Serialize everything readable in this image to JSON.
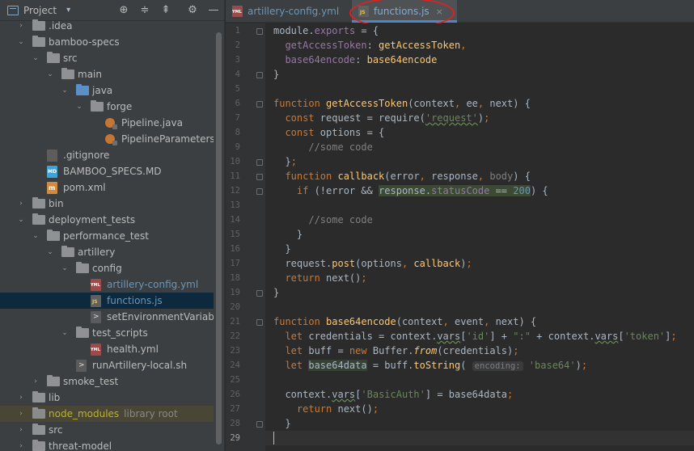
{
  "project_panel": {
    "title": "Project",
    "tree": [
      {
        "label": ".idea",
        "depth": 1,
        "arrow": "collapsed",
        "icon": "folder"
      },
      {
        "label": "bamboo-specs",
        "depth": 1,
        "arrow": "expanded",
        "icon": "folder"
      },
      {
        "label": "src",
        "depth": 2,
        "arrow": "expanded",
        "icon": "folder"
      },
      {
        "label": "main",
        "depth": 3,
        "arrow": "expanded",
        "icon": "folder"
      },
      {
        "label": "java",
        "depth": 4,
        "arrow": "expanded",
        "icon": "folder-src"
      },
      {
        "label": "forge",
        "depth": 5,
        "arrow": "expanded",
        "icon": "folder"
      },
      {
        "label": "Pipeline.java",
        "depth": 6,
        "arrow": "none",
        "icon": "java"
      },
      {
        "label": "PipelineParameters.java",
        "depth": 6,
        "arrow": "none",
        "icon": "java"
      },
      {
        "label": ".gitignore",
        "depth": 2,
        "arrow": "none",
        "icon": "ignore"
      },
      {
        "label": "BAMBOO_SPECS.MD",
        "depth": 2,
        "arrow": "none",
        "icon": "md"
      },
      {
        "label": "pom.xml",
        "depth": 2,
        "arrow": "none",
        "icon": "xml"
      },
      {
        "label": "bin",
        "depth": 1,
        "arrow": "collapsed",
        "icon": "folder"
      },
      {
        "label": "deployment_tests",
        "depth": 1,
        "arrow": "expanded",
        "icon": "folder"
      },
      {
        "label": "performance_test",
        "depth": 2,
        "arrow": "expanded",
        "icon": "folder"
      },
      {
        "label": "artillery",
        "depth": 3,
        "arrow": "expanded",
        "icon": "folder"
      },
      {
        "label": "config",
        "depth": 4,
        "arrow": "expanded",
        "icon": "folder"
      },
      {
        "label": "artillery-config.yml",
        "depth": 5,
        "arrow": "none",
        "icon": "yml",
        "modified": true
      },
      {
        "label": "functions.js",
        "depth": 5,
        "arrow": "none",
        "icon": "js",
        "modified": true,
        "selected": true
      },
      {
        "label": "setEnvironmentVariables.sh",
        "depth": 5,
        "arrow": "none",
        "icon": "sh"
      },
      {
        "label": "test_scripts",
        "depth": 4,
        "arrow": "expanded",
        "icon": "folder"
      },
      {
        "label": "health.yml",
        "depth": 5,
        "arrow": "none",
        "icon": "yml"
      },
      {
        "label": "runArtillery-local.sh",
        "depth": 4,
        "arrow": "none",
        "icon": "sh"
      },
      {
        "label": "smoke_test",
        "depth": 2,
        "arrow": "collapsed",
        "icon": "folder"
      },
      {
        "label": "lib",
        "depth": 1,
        "arrow": "collapsed",
        "icon": "folder"
      },
      {
        "label": "node_modules",
        "depth": 1,
        "arrow": "collapsed",
        "icon": "folder-lib",
        "ignored": true,
        "suffix": "library root"
      },
      {
        "label": "src",
        "depth": 1,
        "arrow": "collapsed",
        "icon": "folder"
      },
      {
        "label": "threat-model",
        "depth": 1,
        "arrow": "collapsed",
        "icon": "folder"
      }
    ]
  },
  "tabs": [
    {
      "label": "artillery-config.yml",
      "icon": "yml",
      "active": false,
      "close": ""
    },
    {
      "label": "functions.js",
      "icon": "js",
      "active": true,
      "close": "×"
    }
  ],
  "editor": {
    "file": "functions.js",
    "current_line": 29,
    "lines": [
      [
        [
          "module",
          "id"
        ],
        [
          ".",
          "p"
        ],
        [
          "exports",
          "fld"
        ],
        [
          " = {",
          "p"
        ]
      ],
      [
        [
          "  getAccessToken",
          "pr"
        ],
        [
          ": ",
          "p"
        ],
        [
          "getAccessToken",
          "fn"
        ],
        [
          ",",
          "k"
        ]
      ],
      [
        [
          "  base64encode",
          "pr"
        ],
        [
          ": ",
          "p"
        ],
        [
          "base64encode",
          "fn"
        ]
      ],
      [
        [
          "}",
          "p"
        ]
      ],
      [],
      [
        [
          "function ",
          "k"
        ],
        [
          "getAccessToken",
          "fn"
        ],
        [
          "(context",
          "p"
        ],
        [
          ", ",
          "k"
        ],
        [
          "ee",
          "p"
        ],
        [
          ", ",
          "k"
        ],
        [
          "next) {",
          "p"
        ]
      ],
      [
        [
          "  const ",
          "k"
        ],
        [
          "request = require(",
          "p"
        ],
        [
          "'request'",
          "st ul"
        ],
        [
          ")",
          "p"
        ],
        [
          ";",
          "k"
        ]
      ],
      [
        [
          "  const ",
          "k"
        ],
        [
          "options = {",
          "p"
        ]
      ],
      [
        [
          "      //some code",
          "cm"
        ]
      ],
      [
        [
          "  }",
          "p"
        ],
        [
          ";",
          "k"
        ]
      ],
      [
        [
          "  function ",
          "k"
        ],
        [
          "callback",
          "fn"
        ],
        [
          "(error",
          "p"
        ],
        [
          ", ",
          "k"
        ],
        [
          "response",
          "p"
        ],
        [
          ", ",
          "k"
        ],
        [
          "body",
          "cm"
        ],
        [
          ") {",
          "p"
        ]
      ],
      [
        [
          "    if ",
          "k"
        ],
        [
          "(!error && ",
          "p"
        ],
        [
          "response",
          "hl"
        ],
        [
          ".",
          "hl"
        ],
        [
          "statusCode",
          "fld hl"
        ],
        [
          " == ",
          "hl"
        ],
        [
          "200",
          "nu hl"
        ],
        [
          ") {",
          "p"
        ]
      ],
      [],
      [
        [
          "      //some code",
          "cm"
        ]
      ],
      [
        [
          "    }",
          "p"
        ]
      ],
      [
        [
          "  }",
          "p"
        ]
      ],
      [
        [
          "  request.",
          "p"
        ],
        [
          "post",
          "fn"
        ],
        [
          "(options",
          "p"
        ],
        [
          ", ",
          "k"
        ],
        [
          "callback",
          "fn"
        ],
        [
          ")",
          "p"
        ],
        [
          ";",
          "k"
        ]
      ],
      [
        [
          "  return ",
          "k"
        ],
        [
          "next()",
          "p"
        ],
        [
          ";",
          "k"
        ]
      ],
      [
        [
          "}",
          "p"
        ]
      ],
      [],
      [
        [
          "function ",
          "k"
        ],
        [
          "base64encode",
          "fn"
        ],
        [
          "(context",
          "p"
        ],
        [
          ", ",
          "k"
        ],
        [
          "event",
          "p"
        ],
        [
          ", ",
          "k"
        ],
        [
          "next) {",
          "p"
        ]
      ],
      [
        [
          "  let ",
          "k"
        ],
        [
          "credentials = context.",
          "p"
        ],
        [
          "vars",
          "ul"
        ],
        [
          "[",
          "p"
        ],
        [
          "'id'",
          "st"
        ],
        [
          "] + ",
          "p"
        ],
        [
          "\":\"",
          "st"
        ],
        [
          " + context.",
          "p"
        ],
        [
          "vars",
          "ul"
        ],
        [
          "[",
          "p"
        ],
        [
          "'token'",
          "st"
        ],
        [
          "]",
          "p"
        ],
        [
          ";",
          "k"
        ]
      ],
      [
        [
          "  let ",
          "k"
        ],
        [
          "buff = ",
          "p"
        ],
        [
          "new ",
          "k"
        ],
        [
          "Buffer.",
          "p"
        ],
        [
          "from",
          "fn it"
        ],
        [
          "(credentials)",
          "p"
        ],
        [
          ";",
          "k"
        ]
      ],
      [
        [
          "  let ",
          "k"
        ],
        [
          "base64data",
          "hl2"
        ],
        [
          " = buff.",
          "p"
        ],
        [
          "toString",
          "fn"
        ],
        [
          "( ",
          "p"
        ],
        [
          "encoding:",
          "hint"
        ],
        [
          " ",
          "p"
        ],
        [
          "'base64'",
          "st"
        ],
        [
          ")",
          "p"
        ],
        [
          ";",
          "k"
        ]
      ],
      [],
      [
        [
          "  context.",
          "p"
        ],
        [
          "vars",
          "ul"
        ],
        [
          "[",
          "p"
        ],
        [
          "'BasicAuth'",
          "st"
        ],
        [
          "] = base64data",
          "p"
        ],
        [
          ";",
          "k"
        ]
      ],
      [
        [
          "    return ",
          "k"
        ],
        [
          "next()",
          "p"
        ],
        [
          ";",
          "k"
        ]
      ],
      [
        [
          "  }",
          "p"
        ]
      ],
      []
    ]
  },
  "icons": [
    "project-icon",
    "locate-icon",
    "expand-all-icon",
    "collapse-all-icon",
    "settings-icon",
    "minimize-icon"
  ]
}
